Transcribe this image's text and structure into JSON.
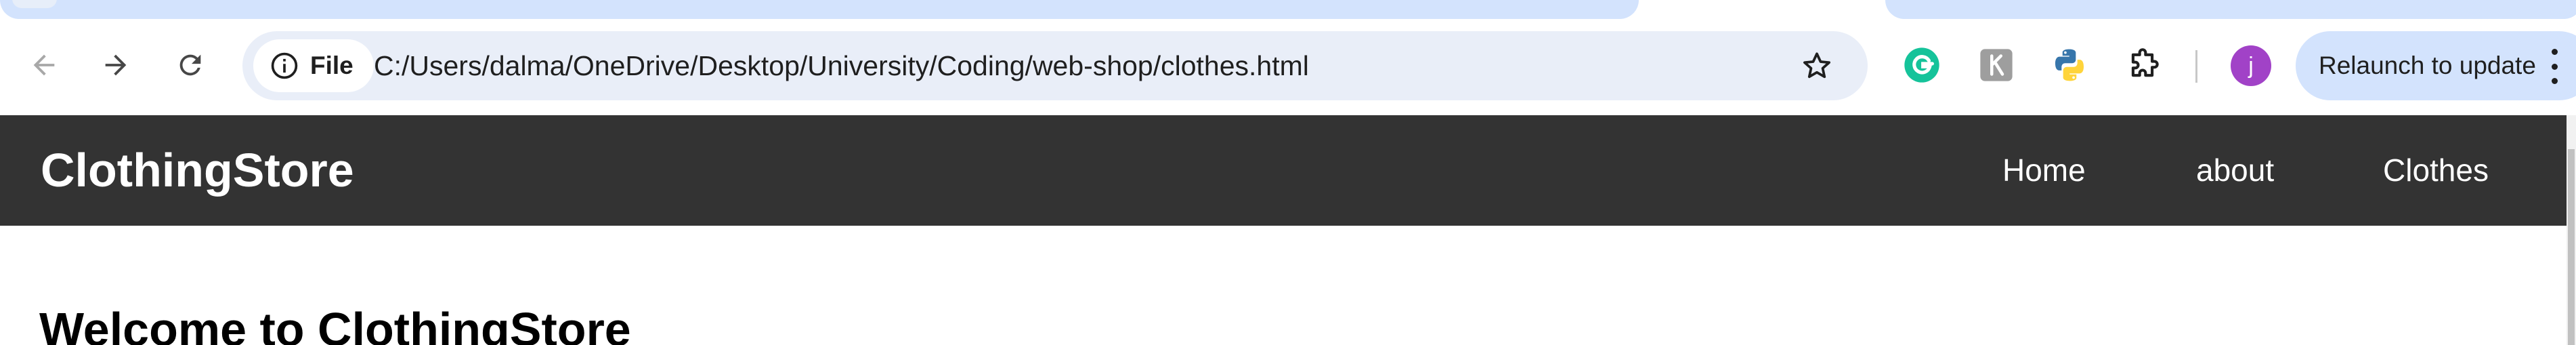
{
  "browser": {
    "site_chip_label": "File",
    "url": "C:/Users/dalma/OneDrive/Desktop/University/Coding/web-shop/clothes.html",
    "profile_initial": "j",
    "relaunch_label": "Relaunch to update",
    "icons": {
      "back": "back-arrow-icon",
      "forward": "forward-arrow-icon",
      "reload": "reload-icon",
      "info": "info-icon",
      "bookmark": "star-icon",
      "extensions": [
        "grammarly-icon",
        "extension-gray-icon",
        "python-icon",
        "puzzle-icon"
      ],
      "menu": "more-vert-icon"
    },
    "colors": {
      "tab_active": "#d3e3fd",
      "omnibox": "#e9eef8",
      "avatar": "#a142c7",
      "grammarly": "#15c39a"
    }
  },
  "site": {
    "brand": "ClothingStore",
    "nav": {
      "home": "Home",
      "about": "about",
      "clothes": "Clothes"
    },
    "heading": "Welcome to ClothingStore",
    "colors": {
      "navbar": "#333333",
      "nav_text": "#ffffff"
    }
  }
}
